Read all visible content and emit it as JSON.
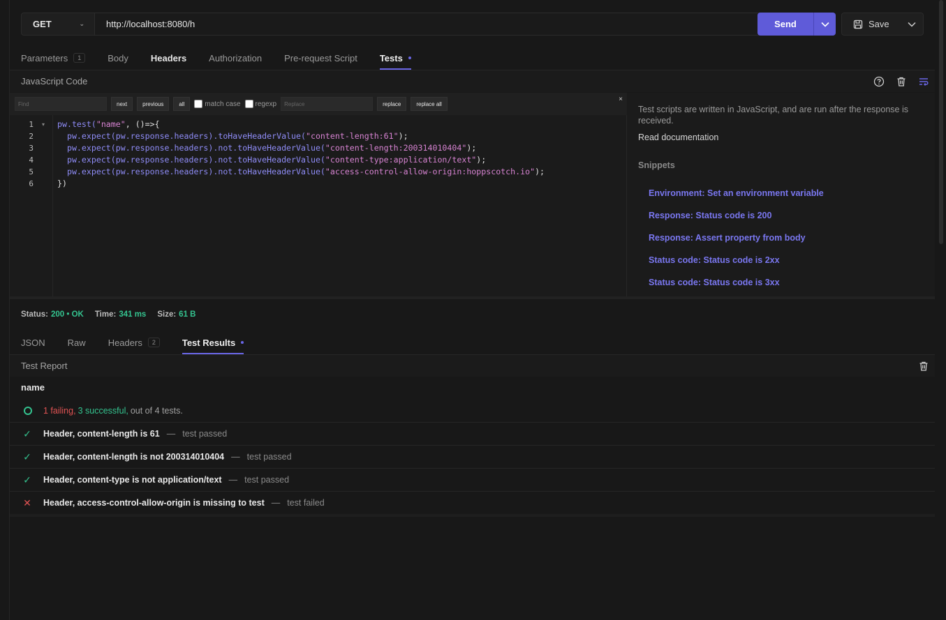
{
  "request": {
    "method": "GET",
    "url": "http://localhost:8080/h",
    "send_label": "Send",
    "save_label": "Save"
  },
  "request_tabs": [
    {
      "label": "Parameters",
      "badge": "1"
    },
    {
      "label": "Body"
    },
    {
      "label": "Headers"
    },
    {
      "label": "Authorization"
    },
    {
      "label": "Pre-request Script"
    },
    {
      "label": "Tests"
    }
  ],
  "editor": {
    "section_title": "JavaScript Code",
    "find": {
      "find_placeholder": "Find",
      "next": "next",
      "previous": "previous",
      "all": "all",
      "match_case": "match case",
      "regexp": "regexp",
      "replace_placeholder": "Replace",
      "replace": "replace",
      "replace_all": "replace all",
      "close": "×"
    },
    "line_numbers": [
      "1",
      "2",
      "3",
      "4",
      "5",
      "6"
    ],
    "lines": {
      "l1_fn": "pw.test(",
      "l1_str": "\"name\"",
      "l1_rest": ", ()=>{",
      "l2_fn": "  pw.expect(pw.response.headers).toHaveHeaderValue(",
      "l2_str": "\"content-length:61\"",
      "l2_rest": ");",
      "l3_fn": "  pw.expect(pw.response.headers).not.toHaveHeaderValue(",
      "l3_str": "\"content-length:200314010404\"",
      "l3_rest": ");",
      "l4_fn": "  pw.expect(pw.response.headers).not.toHaveHeaderValue(",
      "l4_str": "\"content-type:application/text\"",
      "l4_rest": ");",
      "l5_fn": "  pw.expect(pw.response.headers).not.toHaveHeaderValue(",
      "l5_str": "\"access-control-allow-origin:hoppscotch.io\"",
      "l5_rest": ");",
      "l6": "})"
    }
  },
  "sidebar": {
    "description": "Test scripts are written in JavaScript, and are run after the response is received.",
    "doc_link": "Read documentation",
    "snippets_title": "Snippets",
    "snippets": [
      "Environment: Set an environment variable",
      "Response: Status code is 200",
      "Response: Assert property from body",
      "Status code: Status code is 2xx",
      "Status code: Status code is 3xx"
    ]
  },
  "response": {
    "status_label": "Status:",
    "status_value": "200  •  OK",
    "time_label": "Time:",
    "time_value": "341 ms",
    "size_label": "Size:",
    "size_value": "61 B"
  },
  "response_tabs": [
    {
      "label": "JSON"
    },
    {
      "label": "Raw"
    },
    {
      "label": "Headers",
      "badge": "2"
    },
    {
      "label": "Test Results"
    }
  ],
  "report": {
    "title": "Test Report",
    "test_name": "name",
    "summary_failing": "1 failing,",
    "summary_success": "3 successful,",
    "summary_total": "out of 4 tests.",
    "results": [
      {
        "name": "Header, content-length is 61",
        "status": "test passed",
        "passed": true
      },
      {
        "name": "Header, content-length is not 200314010404",
        "status": "test passed",
        "passed": true
      },
      {
        "name": "Header, content-type is not application/text",
        "status": "test passed",
        "passed": true
      },
      {
        "name": "Header, access-control-allow-origin is missing to test",
        "status": "test failed",
        "passed": false
      }
    ]
  },
  "colors": {
    "accent": "#6a66e6",
    "send": "#5f5bd9",
    "success": "#34c38f",
    "failure": "#e05353",
    "background": "#181818"
  }
}
